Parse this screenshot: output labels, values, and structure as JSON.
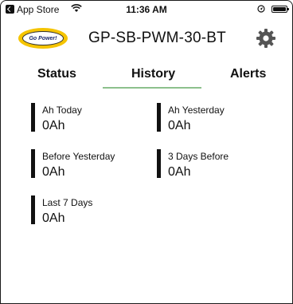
{
  "status_bar": {
    "app_label": "App Store",
    "time": "11:36 AM"
  },
  "header": {
    "logo_text": "Go Power!",
    "title": "GP-SB-PWM-30-BT",
    "settings_icon": "gear-icon"
  },
  "tabs": [
    {
      "label": "Status",
      "active": false
    },
    {
      "label": "History",
      "active": true
    },
    {
      "label": "Alerts",
      "active": false
    }
  ],
  "history": {
    "items": [
      {
        "label": "Ah Today",
        "value": "0Ah"
      },
      {
        "label": "Ah Yesterday",
        "value": "0Ah"
      },
      {
        "label": "Before Yesterday",
        "value": "0Ah"
      },
      {
        "label": "3 Days Before",
        "value": "0Ah"
      },
      {
        "label": "Last 7 Days",
        "value": "0Ah"
      }
    ]
  },
  "colors": {
    "tab_indicator": "#8cc08c",
    "logo_yellow": "#f5c400",
    "logo_text": "#1b2a6b"
  }
}
